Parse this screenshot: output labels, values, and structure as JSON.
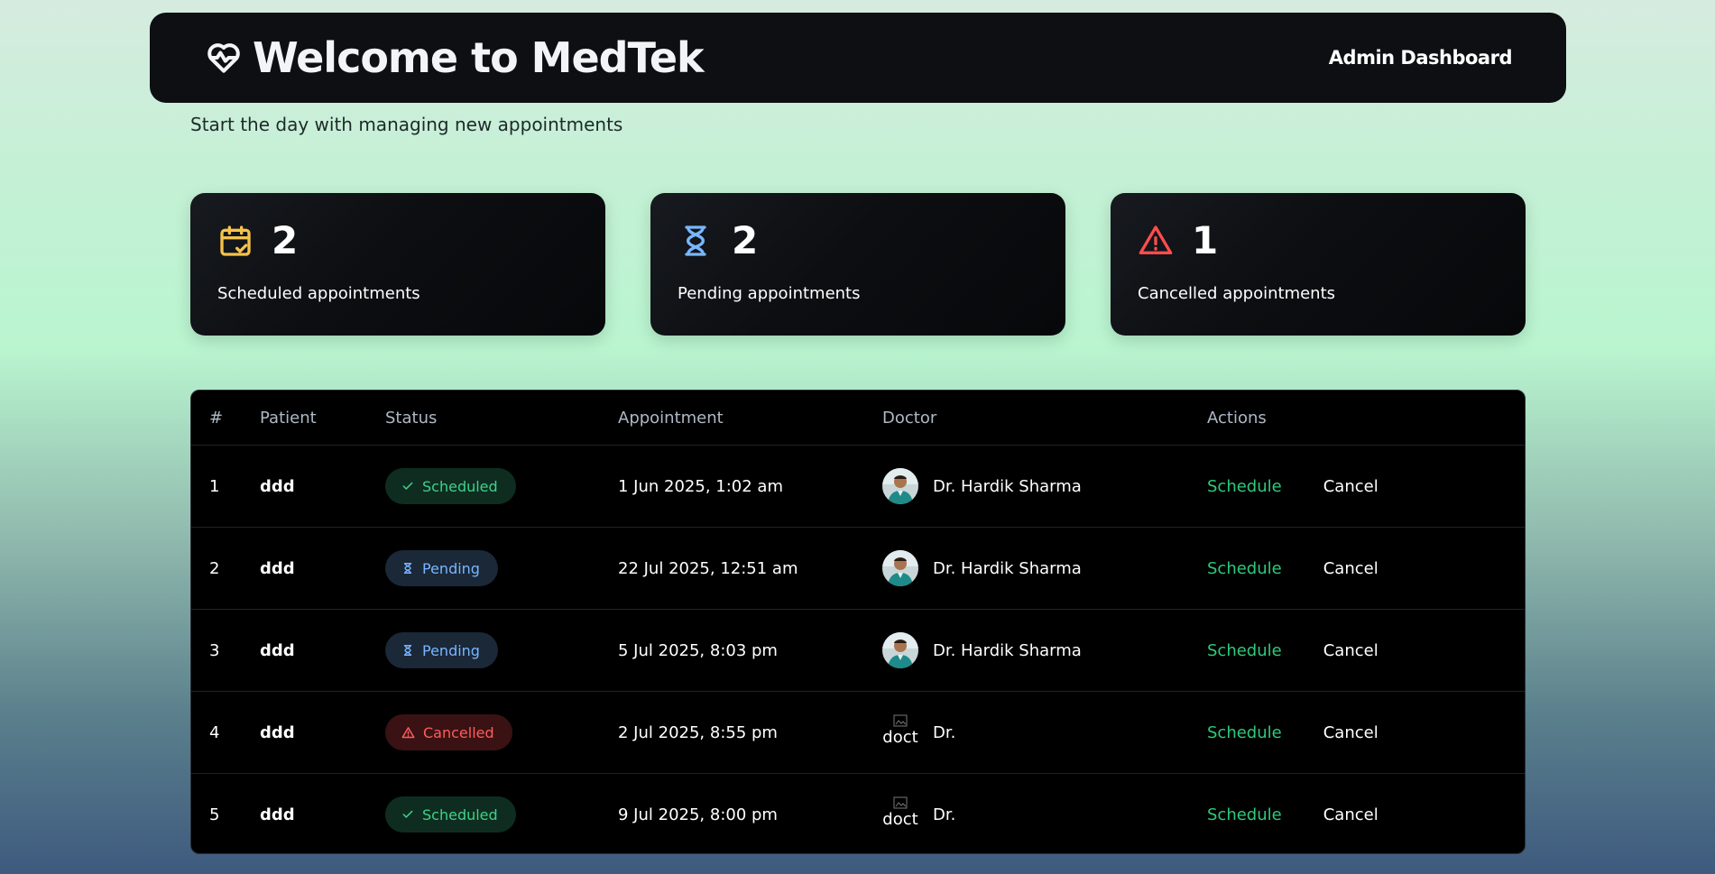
{
  "header": {
    "title": "Welcome to MedTek",
    "admin_link": "Admin Dashboard"
  },
  "subtitle": "Start the day with managing new appointments",
  "stats": [
    {
      "count": "2",
      "label": "Scheduled appointments",
      "icon": "calendar-check-icon",
      "color": "#f5c34b"
    },
    {
      "count": "2",
      "label": "Pending appointments",
      "icon": "hourglass-icon",
      "color": "#79b6ff"
    },
    {
      "count": "1",
      "label": "Cancelled appointments",
      "icon": "warning-icon",
      "color": "#ff4d4d"
    }
  ],
  "table": {
    "headers": [
      "#",
      "Patient",
      "Status",
      "Appointment",
      "Doctor",
      "Actions"
    ],
    "rows": [
      {
        "num": "1",
        "patient": "ddd",
        "status": "Scheduled",
        "appointment": "1 Jun 2025, 1:02 am",
        "doctor": "Dr. Hardik Sharma",
        "avatar_alt": "",
        "schedule": "Schedule",
        "cancel": "Cancel"
      },
      {
        "num": "2",
        "patient": "ddd",
        "status": "Pending",
        "appointment": "22 Jul 2025, 12:51 am",
        "doctor": "Dr. Hardik Sharma",
        "avatar_alt": "",
        "schedule": "Schedule",
        "cancel": "Cancel"
      },
      {
        "num": "3",
        "patient": "ddd",
        "status": "Pending",
        "appointment": "5 Jul 2025, 8:03 pm",
        "doctor": "Dr. Hardik Sharma",
        "avatar_alt": "",
        "schedule": "Schedule",
        "cancel": "Cancel"
      },
      {
        "num": "4",
        "patient": "ddd",
        "status": "Cancelled",
        "appointment": "2 Jul 2025, 8:55 pm",
        "doctor": "Dr.",
        "avatar_alt": "doct",
        "schedule": "Schedule",
        "cancel": "Cancel"
      },
      {
        "num": "5",
        "patient": "ddd",
        "status": "Scheduled",
        "appointment": "9 Jul 2025, 8:00 pm",
        "doctor": "Dr.",
        "avatar_alt": "doct",
        "schedule": "Schedule",
        "cancel": "Cancel"
      }
    ]
  },
  "colors": {
    "scheduled": "#3fd18a",
    "pending": "#79b6ff",
    "cancelled": "#ff5c5c",
    "action_schedule": "#2fc97a"
  }
}
